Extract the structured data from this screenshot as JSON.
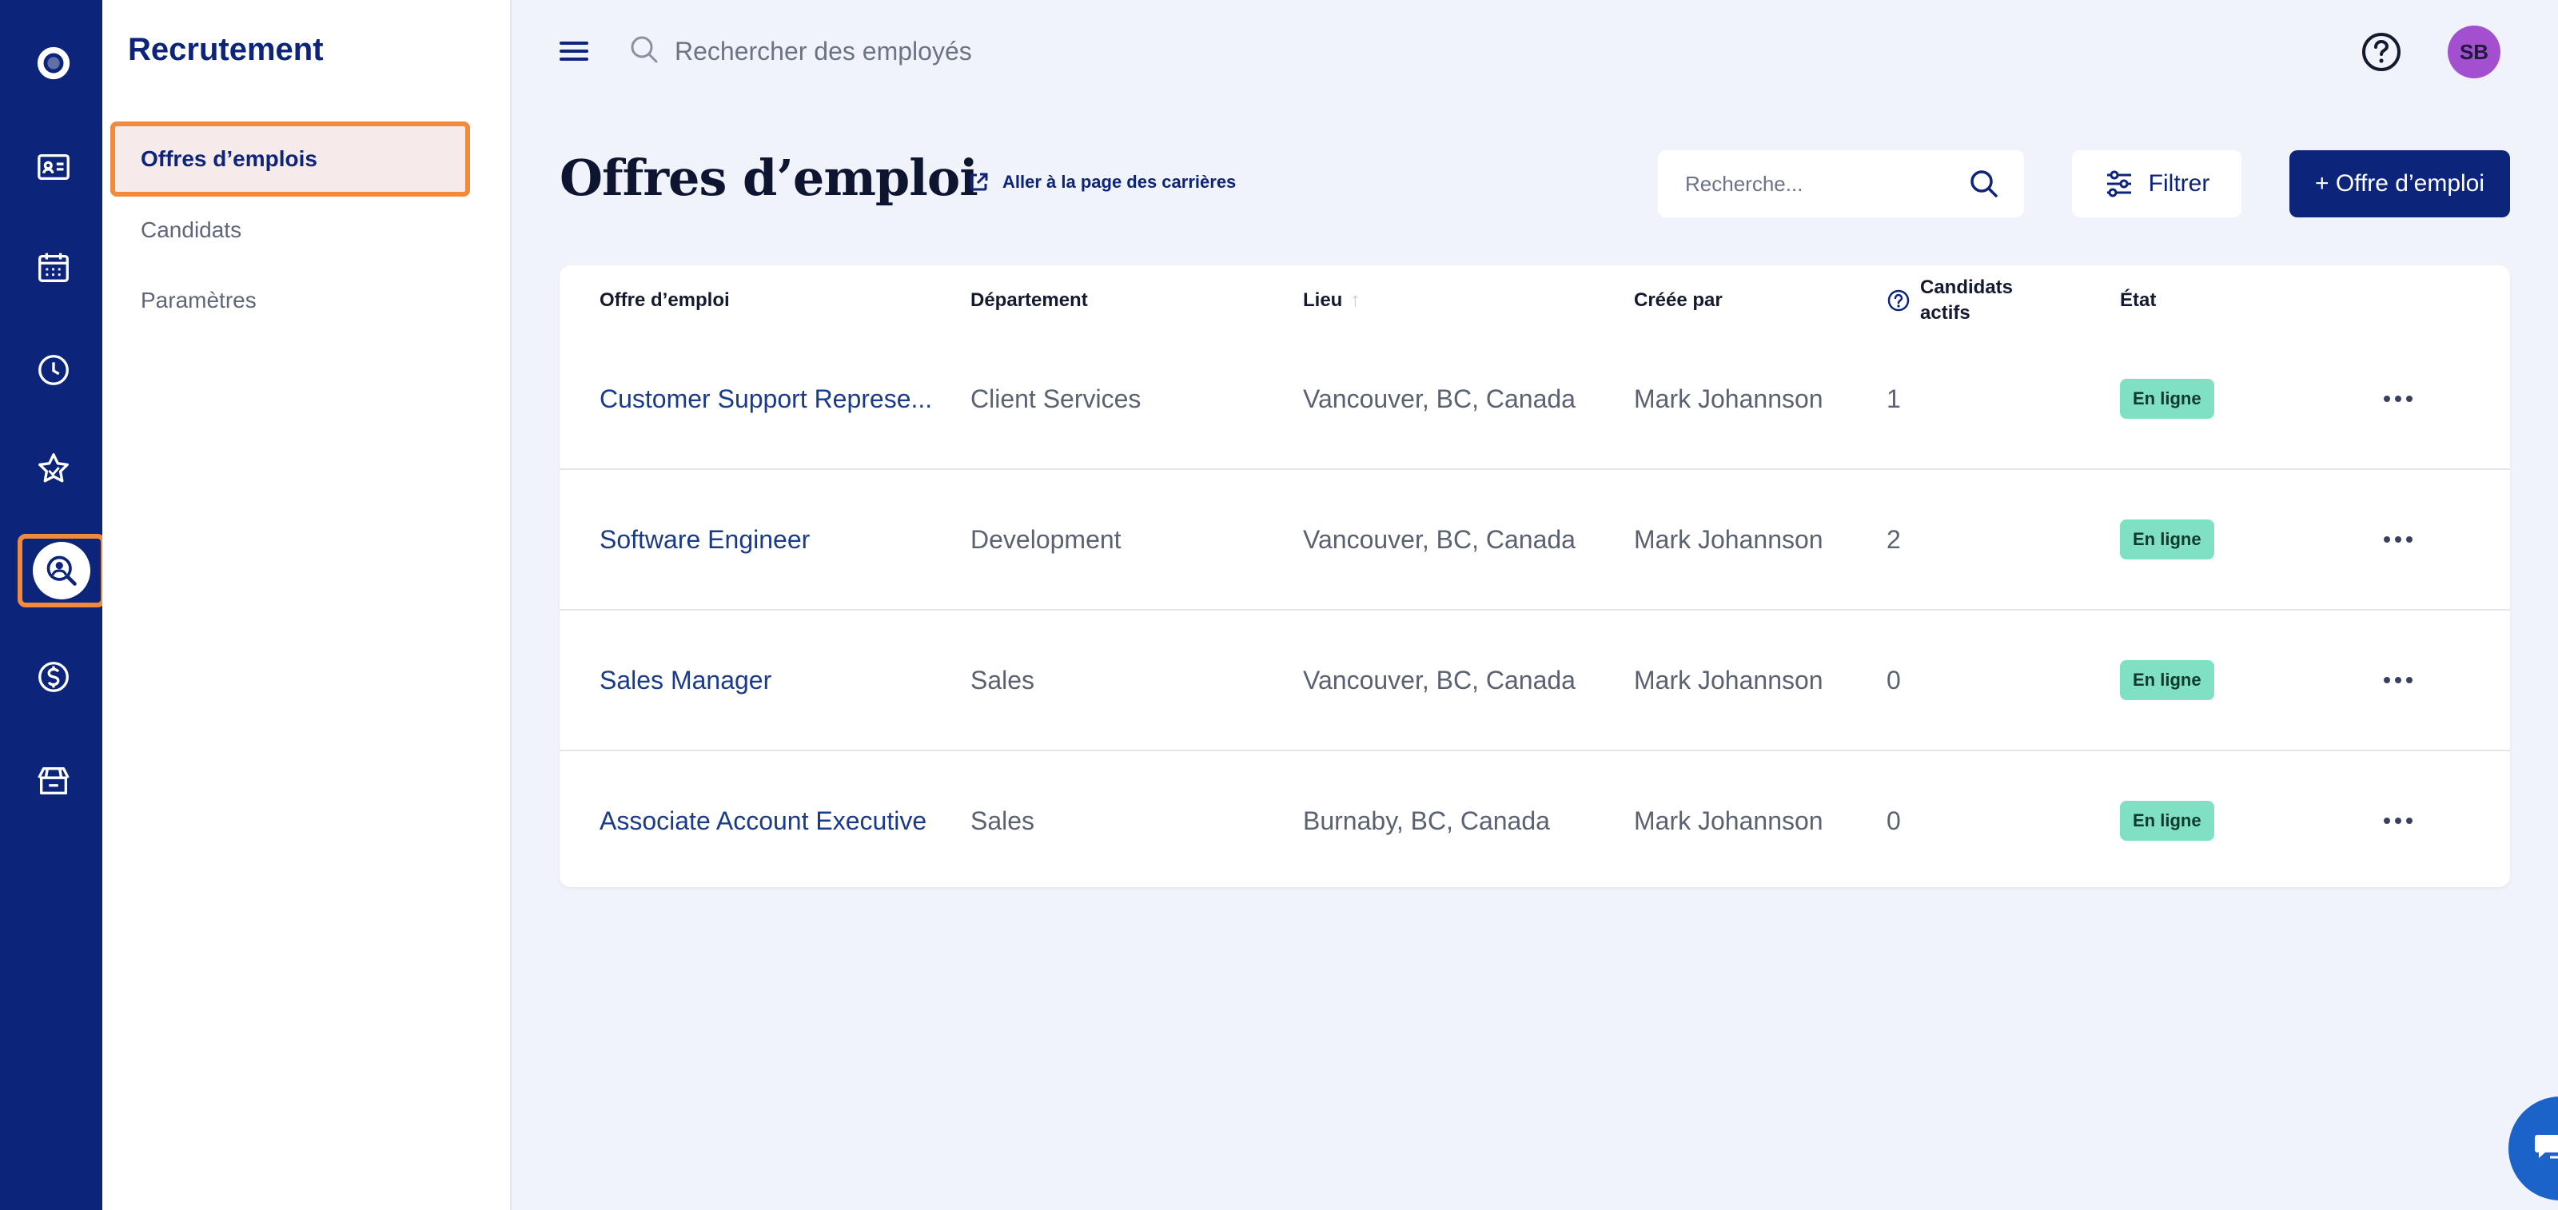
{
  "rail": {
    "items": [
      {
        "name": "home-icon"
      },
      {
        "name": "employee-directory-icon"
      },
      {
        "name": "calendar-icon"
      },
      {
        "name": "time-icon"
      },
      {
        "name": "performance-star-icon"
      },
      {
        "name": "recruitment-search-icon",
        "active": true
      },
      {
        "name": "payroll-dollar-icon"
      },
      {
        "name": "benefits-box-icon"
      }
    ]
  },
  "sidebar": {
    "title": "Recrutement",
    "items": [
      {
        "label": "Offres d’emplois",
        "active": true
      },
      {
        "label": "Candidats"
      },
      {
        "label": "Paramètres"
      }
    ]
  },
  "topbar": {
    "search_placeholder": "Rechercher des employés",
    "avatar_initials": "SB"
  },
  "page": {
    "title": "Offres d’emploi",
    "careers_link": "Aller à la page des carrières",
    "search_placeholder": "Recherche...",
    "filter_label": "Filtrer",
    "add_label": "+ Offre d’emploi"
  },
  "table": {
    "headers": {
      "job": "Offre d’emploi",
      "department": "Département",
      "location": "Lieu",
      "location_sort": "↑",
      "created_by": "Créée par",
      "active_candidates_1": "Candidats",
      "active_candidates_2": "actifs",
      "status": "État"
    },
    "rows": [
      {
        "job": "Customer Support Represe...",
        "department": "Client Services",
        "location": "Vancouver, BC, Canada",
        "created_by": "Mark Johannson",
        "candidates": "1",
        "status": "En ligne"
      },
      {
        "job": "Software Engineer",
        "department": "Development",
        "location": "Vancouver, BC, Canada",
        "created_by": "Mark Johannson",
        "candidates": "2",
        "status": "En ligne"
      },
      {
        "job": "Sales Manager",
        "department": "Sales",
        "location": "Vancouver, BC, Canada",
        "created_by": "Mark Johannson",
        "candidates": "0",
        "status": "En ligne"
      },
      {
        "job": "Associate Account Executive",
        "department": "Sales",
        "location": "Burnaby, BC, Canada",
        "created_by": "Mark Johannson",
        "candidates": "0",
        "status": "En ligne"
      }
    ]
  },
  "colors": {
    "brand": "#0c2479",
    "highlight": "#f28a3c",
    "badge_bg": "#7fe0c3",
    "avatar_bg": "#a24fd0",
    "chat_bg": "#1c63c9"
  }
}
